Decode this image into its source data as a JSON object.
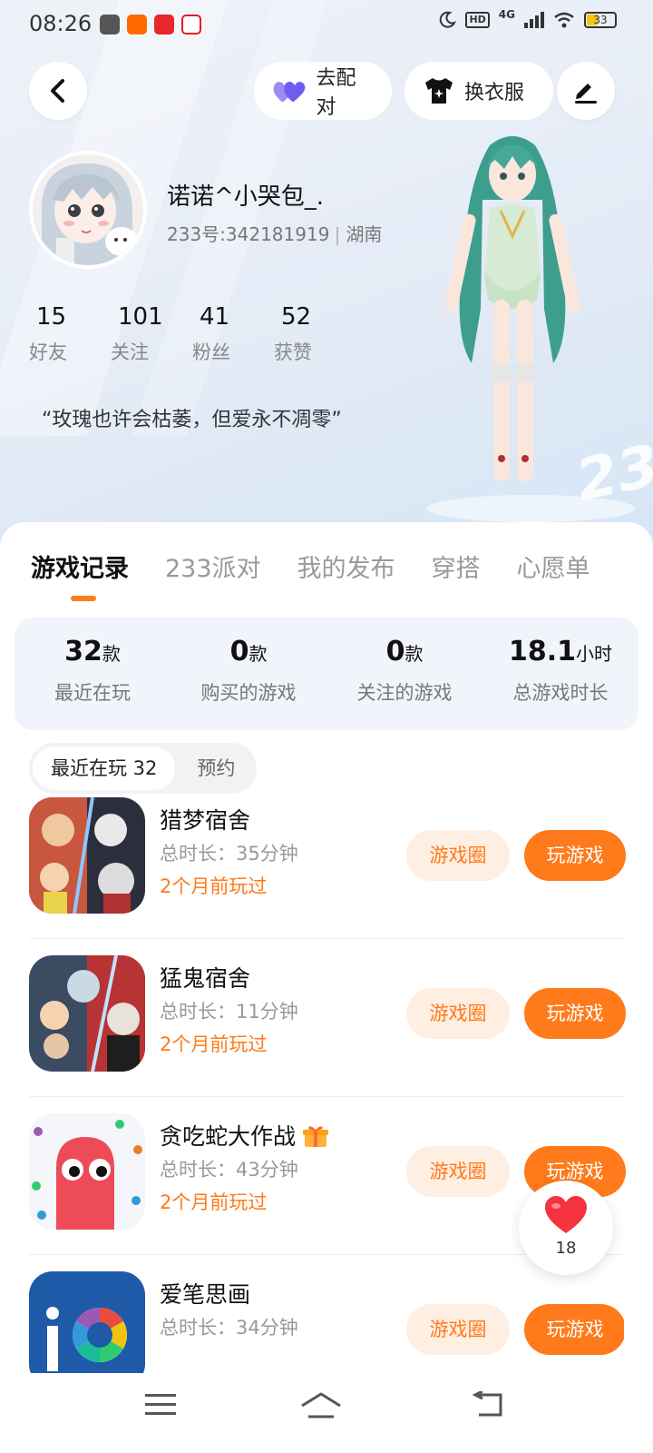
{
  "status_bar": {
    "time": "08:26",
    "network": "4G",
    "hd": "HD",
    "battery": "33"
  },
  "header": {
    "pair_label": "去配对",
    "dress_label": "换衣服"
  },
  "profile": {
    "username": "诺诺^小哭包_.",
    "id": "233号:342181919",
    "location": "湖南",
    "stats": [
      {
        "value": "15",
        "label": "好友"
      },
      {
        "value": "101",
        "label": "关注"
      },
      {
        "value": "41",
        "label": "粉丝"
      },
      {
        "value": "52",
        "label": "获赞"
      }
    ],
    "motto": "“玫瑰也许会枯萎，但爱永不凋零”"
  },
  "tabs": [
    "游戏记录",
    "233派对",
    "我的发布",
    "穿搭",
    "心愿单"
  ],
  "summary": [
    {
      "value": "32",
      "unit": "款",
      "label": "最近在玩"
    },
    {
      "value": "0",
      "unit": "款",
      "label": "购买的游戏"
    },
    {
      "value": "0",
      "unit": "款",
      "label": "关注的游戏"
    },
    {
      "value": "18.1",
      "unit": "小时",
      "label": "总游戏时长"
    }
  ],
  "filters": [
    "最近在玩 32",
    "预约"
  ],
  "games": [
    {
      "name": "猎梦宿舍",
      "duration": "总时长：35分钟",
      "last_played": "2个月前玩过",
      "circle_label": "游戏圈",
      "play_label": "玩游戏"
    },
    {
      "name": "猛鬼宿舍",
      "duration": "总时长：11分钟",
      "last_played": "2个月前玩过",
      "circle_label": "游戏圈",
      "play_label": "玩游戏"
    },
    {
      "name": "贪吃蛇大作战",
      "duration": "总时长：43分钟",
      "last_played": "2个月前玩过",
      "circle_label": "游戏圈",
      "play_label": "玩游戏"
    },
    {
      "name": "爱笔思画",
      "duration": "总时长：34分钟",
      "last_played": "",
      "circle_label": "游戏圈",
      "play_label": "玩游戏"
    }
  ],
  "favorite": {
    "count": "18"
  },
  "colors": {
    "accent": "#ff7a1a",
    "accent_light": "#ffeee2",
    "summary_bg": "#f1f4fa"
  }
}
